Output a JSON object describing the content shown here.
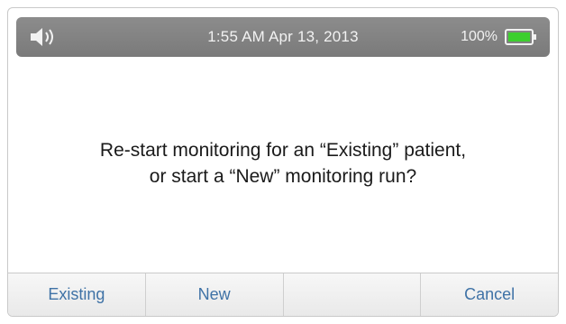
{
  "status_bar": {
    "datetime": "1:55 AM  Apr 13, 2013",
    "battery_percent": "100%",
    "speaker_icon": "speaker-volume-icon",
    "battery_icon": "battery-full-icon",
    "battery_color": "#3ccf2e"
  },
  "dialog": {
    "message_line1": "Re-start monitoring for an “Existing” patient,",
    "message_line2": "or start a “New” monitoring run?"
  },
  "softkeys": {
    "key1": "Existing",
    "key2": "New",
    "key3": "",
    "key4": "Cancel"
  },
  "colors": {
    "status_bar_bg": "#808080",
    "softkey_text": "#3f72a6"
  }
}
